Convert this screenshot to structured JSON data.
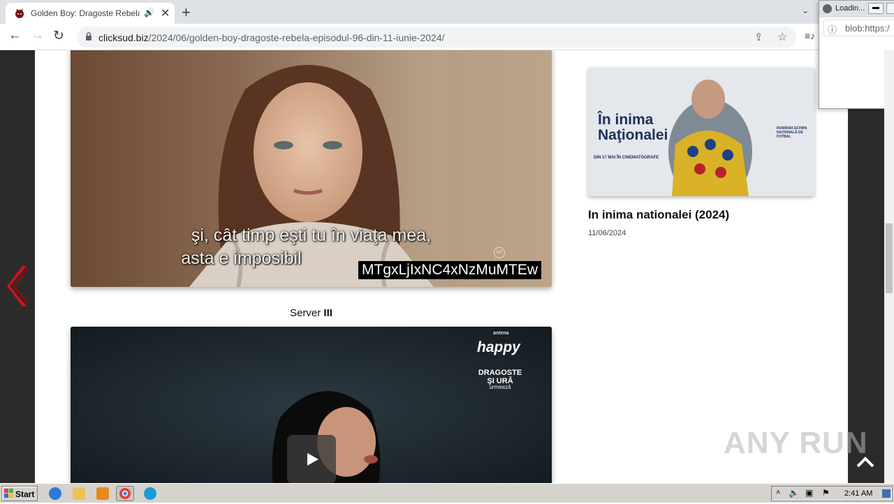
{
  "browser": {
    "tab_title": "Golden Boy: Dragoste Rebela E",
    "url_domain": "clicksud.biz",
    "url_path": "/2024/06/golden-boy-dragoste-rebela-episodul-96-din-11-iunie-2024/"
  },
  "popup": {
    "title": "Loadin...",
    "address": "blob:https:/"
  },
  "video1": {
    "subtitle_line1": "şi, cât timp eşti tu în viaţa mea,",
    "subtitle_line2": "asta e imposibil",
    "overlay_code": "MTgxLjIxNC4xNzMuMTEw",
    "ap_logo": "AP"
  },
  "server": {
    "prefix": "Server ",
    "number": "III"
  },
  "video2": {
    "channel_small": "antena",
    "channel_logo": "happy",
    "next_title": "DRAGOSTE\nŞI URĂ",
    "next_label": "urmează"
  },
  "sidebar_post": {
    "poster_headline": "În inima Naţionalei",
    "poster_release": "DIN 17 MAI ÎN CINEMATOGRAFE",
    "poster_partner": "ROMÂNIA ECHIPA NAŢIONALĂ DE FOTBAL",
    "title": "In inima nationalei (2024)",
    "date": "11/06/2024"
  },
  "watermark": "ANY RUN",
  "taskbar": {
    "start_label": "Start",
    "clock": "2:41 AM"
  },
  "colors": {
    "side_bars": "#2b2b2b",
    "arrow_red": "#d0121a",
    "chrome_bg": "#dee1e6"
  }
}
